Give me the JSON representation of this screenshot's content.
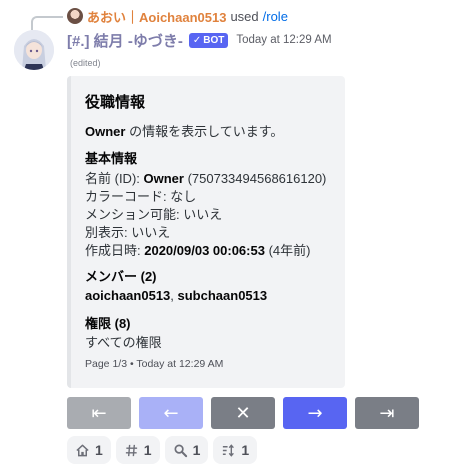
{
  "reply": {
    "name": "あおい｜Aoichaan0513",
    "action": "used",
    "command": "/role"
  },
  "message": {
    "author": "[#.] 結月 -ゆづき-",
    "badge_check": "✓",
    "badge": "BOT",
    "timestamp": "Today at 12:29 AM",
    "edited": "(edited)"
  },
  "embed": {
    "title": "役職情報",
    "desc_bold": "Owner",
    "desc_rest": " の情報を表示しています。",
    "basic": {
      "title": "基本情報",
      "name_label": "名前 (ID): ",
      "name_value": "Owner",
      "name_id": " (750733494568616120)",
      "color_line": "カラーコード: なし",
      "mention_line": "メンション可能: いいえ",
      "separate_line": "別表示: いいえ",
      "created_label": "作成日時: ",
      "created_value": "2020/09/03 00:06:53",
      "created_rel": " (4年前)"
    },
    "members": {
      "title": "メンバー",
      "count": " (2)",
      "member1": "aoichaan0513",
      "sep": ", ",
      "member2": "subchaan0513"
    },
    "perms": {
      "title": "権限",
      "count": " (8)",
      "value": "すべての権限"
    },
    "footer": "Page 1/3 • Today at 12:29 AM"
  },
  "buttons": [
    {
      "icon": "first-page-icon",
      "glyph": "⇤",
      "style": "grey",
      "disabled": true
    },
    {
      "icon": "arrow-left-icon",
      "glyph": "←",
      "style": "blue",
      "disabled": true
    },
    {
      "icon": "close-icon",
      "glyph": "✕",
      "style": "grey",
      "disabled": false
    },
    {
      "icon": "arrow-right-icon",
      "glyph": "→",
      "style": "blue",
      "disabled": false
    },
    {
      "icon": "last-page-icon",
      "glyph": "⇥",
      "style": "grey",
      "disabled": false
    }
  ],
  "reactions": [
    {
      "icon": "house-icon",
      "count": "1"
    },
    {
      "icon": "hash-icon",
      "count": "1"
    },
    {
      "icon": "magnifier-icon",
      "count": "1"
    },
    {
      "icon": "sort-icon",
      "count": "1"
    }
  ],
  "colors": {
    "blurple": "#5865f2",
    "reply_name": "#e0823d",
    "bot_name": "#7e7dab",
    "link": "#006ce7"
  }
}
